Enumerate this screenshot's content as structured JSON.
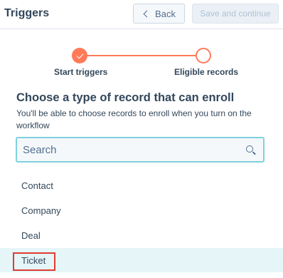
{
  "header": {
    "title": "Triggers",
    "back_label": "Back",
    "save_label": "Save and continue"
  },
  "stepper": {
    "steps": [
      {
        "label": "Start triggers",
        "status": "complete"
      },
      {
        "label": "Eligible records",
        "status": "incomplete"
      }
    ]
  },
  "main": {
    "heading": "Choose a type of record that can enroll",
    "subtext": "You'll be able to choose records to enroll when you turn on the workflow"
  },
  "search": {
    "placeholder": "Search",
    "value": ""
  },
  "options": [
    {
      "label": "Contact"
    },
    {
      "label": "Company"
    },
    {
      "label": "Deal"
    },
    {
      "label": "Ticket",
      "selected": true
    }
  ],
  "colors": {
    "accent": "#ff7a59",
    "focus_border": "#7fd1de",
    "selected_bg": "#e5f5f8",
    "annotation": "#e03c31"
  }
}
